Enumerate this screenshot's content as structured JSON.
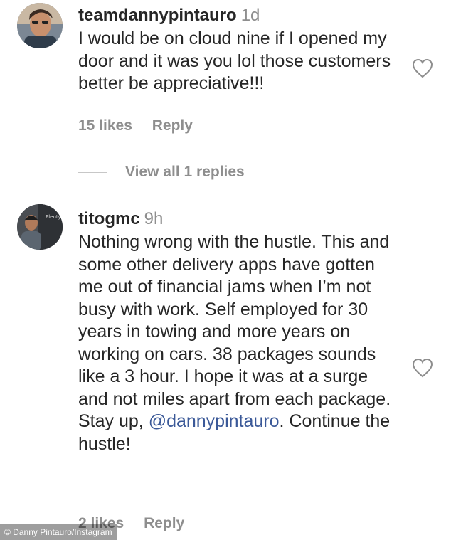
{
  "comments": [
    {
      "username": "teamdannypintauro",
      "time": "1d",
      "text": "I would be on cloud nine if I opened my door and it was you lol those customers better be appreciative!!!",
      "likes": "15 likes",
      "reply_label": "Reply",
      "heart_icon": "heart-outline-icon",
      "avatar_icon": "user-avatar-icon"
    },
    {
      "username": "titogmc",
      "time": "9h",
      "text_before": "Nothing wrong with the hustle. This and some other delivery apps have gotten me out of financial jams when I’m not busy with work. Self employed for 30 years in towing and more years on working on cars. 38 packages sounds like a 3 hour. I hope it was at a surge and not miles apart from each package. Stay up,",
      "mention": "@dannypintauro",
      "text_after": ". Continue the hustle!",
      "likes": "2 likes",
      "reply_label": "Reply",
      "heart_icon": "heart-outline-icon",
      "avatar_icon": "user-avatar-icon"
    }
  ],
  "view_replies": "View all 1 replies",
  "credit": "© Danny Pintauro/Instagram",
  "colors": {
    "text": "#262626",
    "secondary": "#8e8e8e",
    "mention": "#3b5998",
    "background": "#ffffff"
  }
}
